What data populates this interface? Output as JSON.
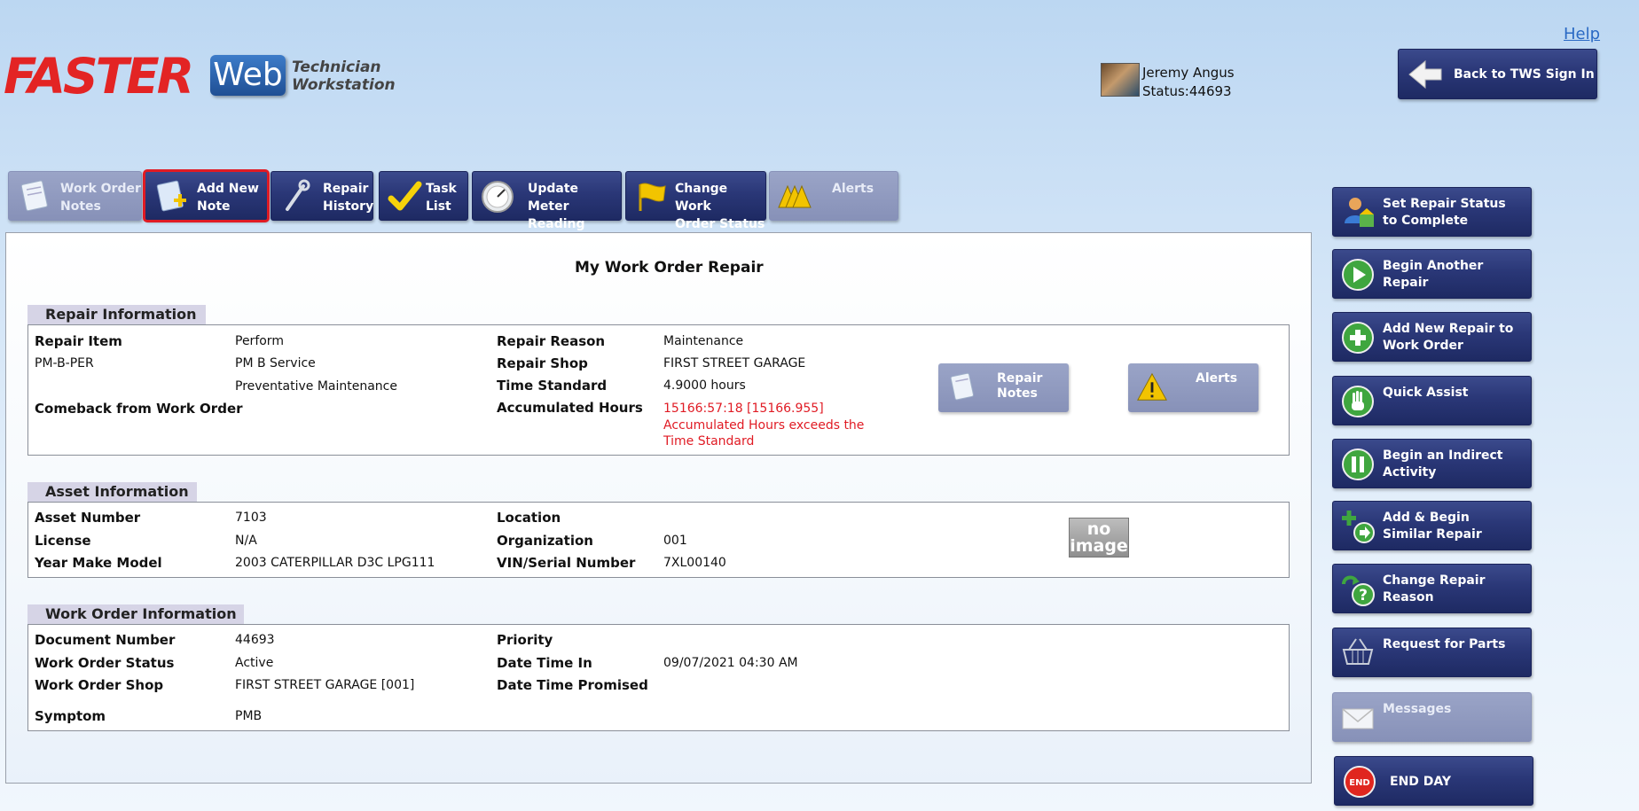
{
  "header": {
    "logo_main": "FASTER",
    "logo_web": "Web",
    "logo_sub_line1": "Technician",
    "logo_sub_line2": "Workstation",
    "help_label": "Help",
    "user_name": "Jeremy Angus",
    "user_status": "Status:44693",
    "back_button_label": "Back to TWS Sign In"
  },
  "tabs": [
    {
      "line1": "Work Order",
      "line2": "Notes",
      "icon": "notes-icon",
      "state": "disabled"
    },
    {
      "line1": "Add New",
      "line2": "Note",
      "icon": "add-note-icon",
      "state": "selected"
    },
    {
      "line1": "Repair",
      "line2": "History",
      "icon": "wrench-icon",
      "state": "normal"
    },
    {
      "line1": "Task",
      "line2": "List",
      "icon": "checkmark-icon",
      "state": "normal"
    },
    {
      "line1": "Update Meter",
      "line2": "Reading",
      "icon": "meter-gauge-icon",
      "state": "normal"
    },
    {
      "line1": "Change Work",
      "line2": "Order Status",
      "icon": "flag-icon",
      "state": "normal"
    },
    {
      "line1": "Alerts",
      "line2": "",
      "icon": "alerts-warning-icon",
      "state": "disabled"
    }
  ],
  "main": {
    "title": "My Work Order Repair",
    "repair_section": {
      "heading": "Repair Information",
      "repair_item_label": "Repair Item",
      "repair_item_value": "Perform",
      "repair_code": "PM-B-PER",
      "repair_desc1": "PM B Service",
      "repair_desc2": "Preventative Maintenance",
      "comeback_label": "Comeback from Work Order",
      "repair_reason_label": "Repair Reason",
      "repair_reason_value": "Maintenance",
      "repair_shop_label": "Repair Shop",
      "repair_shop_value": "FIRST STREET GARAGE",
      "time_standard_label": "Time Standard",
      "time_standard_value": "4.9000 hours",
      "accumulated_label": "Accumulated Hours",
      "accumulated_value": "15166:57:18 [15166.955]",
      "accumulated_warning1": "Accumulated Hours exceeds the",
      "accumulated_warning2": "Time Standard",
      "repair_notes_btn_line1": "Repair",
      "repair_notes_btn_line2": "Notes",
      "alerts_btn": "Alerts"
    },
    "asset_section": {
      "heading": "Asset Information",
      "asset_number_label": "Asset Number",
      "asset_number_value": "7103",
      "license_label": "License",
      "license_value": "N/A",
      "ymm_label": "Year Make Model",
      "ymm_value": "2003 CATERPILLAR D3C LPG111",
      "location_label": "Location",
      "organization_label": "Organization",
      "organization_value": "001",
      "vin_label": "VIN/Serial Number",
      "vin_value": "7XL00140",
      "no_image_line1": "no",
      "no_image_line2": "image"
    },
    "wo_section": {
      "heading": "Work Order Information",
      "doc_label": "Document Number",
      "doc_value": "44693",
      "status_label": "Work Order Status",
      "status_value": "Active",
      "shop_label": "Work Order Shop",
      "shop_value": "FIRST STREET GARAGE [001]",
      "symptom_label": "Symptom",
      "symptom_value": "PMB",
      "priority_label": "Priority",
      "datein_label": "Date Time In",
      "datein_value": "09/07/2021 04:30 AM",
      "promised_label": "Date Time Promised"
    }
  },
  "side_buttons": [
    {
      "line1": "Set Repair Status",
      "line2": "to Complete",
      "icon": "complete-status-icon",
      "state": "normal"
    },
    {
      "line1": "Begin Another",
      "line2": "Repair",
      "icon": "play-icon",
      "state": "normal"
    },
    {
      "line1": "Add New Repair to",
      "line2": "Work Order",
      "icon": "plus-icon",
      "state": "normal"
    },
    {
      "line1": "Quick Assist",
      "line2": "",
      "icon": "hand-stop-icon",
      "state": "normal"
    },
    {
      "line1": "Begin an Indirect",
      "line2": "Activity",
      "icon": "pause-icon",
      "state": "normal"
    },
    {
      "line1": "Add & Begin",
      "line2": "Similar Repair",
      "icon": "add-begin-icon",
      "state": "normal"
    },
    {
      "line1": "Change Repair",
      "line2": "Reason",
      "icon": "question-icon",
      "state": "normal"
    },
    {
      "line1": "Request for Parts",
      "line2": "",
      "icon": "parts-basket-icon",
      "state": "normal"
    },
    {
      "line1": "Messages",
      "line2": "",
      "icon": "envelope-icon",
      "state": "disabled"
    },
    {
      "line1": "END DAY",
      "line2": "",
      "icon": "end-day-icon",
      "state": "normal"
    }
  ]
}
